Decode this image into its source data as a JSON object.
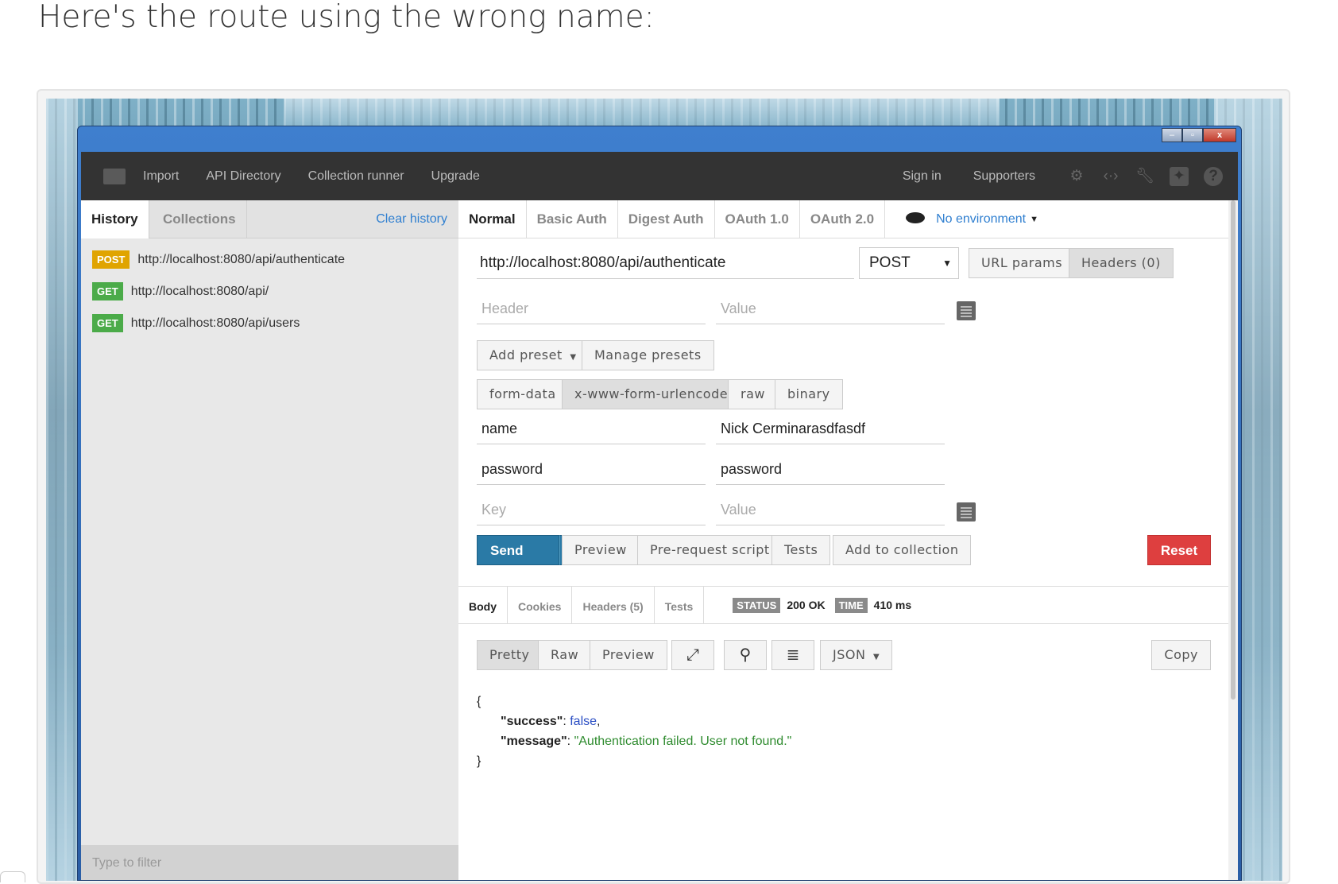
{
  "caption": "Here's the route using the wrong name:",
  "window": {
    "buttons": [
      "–",
      "▫",
      "x"
    ]
  },
  "topbar": {
    "nav": [
      "Import",
      "API Directory",
      "Collection runner",
      "Upgrade"
    ],
    "sign_in": "Sign in",
    "supporters": "Supporters",
    "icons": [
      "interceptor-icon",
      "code-icon",
      "wrench-icon",
      "twitter-icon",
      "help-icon"
    ]
  },
  "sidebar": {
    "tabs": [
      "History",
      "Collections"
    ],
    "clear_history": "Clear history",
    "history": [
      {
        "method": "POST",
        "url": "http://localhost:8080/api/authenticate"
      },
      {
        "method": "GET",
        "url": "http://localhost:8080/api/"
      },
      {
        "method": "GET",
        "url": "http://localhost:8080/api/users"
      }
    ],
    "filter_placeholder": "Type to filter"
  },
  "request": {
    "auth_tabs": [
      "Normal",
      "Basic Auth",
      "Digest Auth",
      "OAuth 1.0",
      "OAuth 2.0"
    ],
    "environment": "No environment",
    "url": "http://localhost:8080/api/authenticate",
    "method": "POST",
    "url_params_label": "URL params",
    "headers_label": "Headers (0)",
    "header_placeholder": "Header",
    "value_placeholder": "Value",
    "add_preset": "Add preset",
    "manage_presets": "Manage presets",
    "body_types": [
      "form-data",
      "x-www-form-urlencoded",
      "raw",
      "binary"
    ],
    "active_body_type": "x-www-form-urlencoded",
    "params": [
      {
        "key": "name",
        "value": "Nick Cerminarasdfasdf"
      },
      {
        "key": "password",
        "value": "password"
      }
    ],
    "key_placeholder": "Key",
    "send": "Send",
    "actions": [
      "Preview",
      "Pre-request script",
      "Tests",
      "Add to collection"
    ],
    "reset": "Reset"
  },
  "response": {
    "tabs": [
      "Body",
      "Cookies",
      "Headers (5)",
      "Tests"
    ],
    "status_label": "STATUS",
    "status": "200 OK",
    "time_label": "TIME",
    "time": "410 ms",
    "views": [
      "Pretty",
      "Raw",
      "Preview"
    ],
    "format": "JSON",
    "copy": "Copy",
    "body": {
      "open": "{",
      "success_key": "\"success\"",
      "success_val": "false",
      "message_key": "\"message\"",
      "message_val": "\"Authentication failed. User not found.\"",
      "close": "}"
    }
  },
  "colors": {
    "send": "#2a7aa6",
    "reset": "#de3f3f",
    "post_badge": "#e0a400",
    "get_badge": "#4bab49",
    "link": "#2f7fd0"
  }
}
